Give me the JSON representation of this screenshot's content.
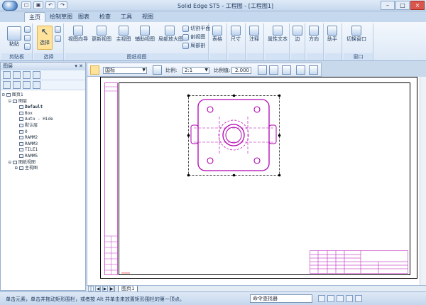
{
  "titlebar": {
    "title": "Solid Edge ST5 - 工程图 - [工程图1]",
    "controls": {
      "minimize": "–",
      "maximize": "□",
      "close": "×"
    }
  },
  "tabs": [
    {
      "label": "主页",
      "active": true
    },
    {
      "label": "绘制草图",
      "active": false
    },
    {
      "label": "图表",
      "active": false
    },
    {
      "label": "检查",
      "active": false
    },
    {
      "label": "工具",
      "active": false
    },
    {
      "label": "视图",
      "active": false
    }
  ],
  "ribbon": {
    "groups": {
      "clipboard": "剪贴板",
      "select": "选择",
      "drawing_views": "图纸视图",
      "window": "窗口"
    },
    "buttons": {
      "paste": "粘贴",
      "select": "选择",
      "view_wizard": "视图向导",
      "update_view": "更新视图",
      "principal_view": "主视图",
      "auxiliary_view": "辅助视图",
      "detail_view": "局部放大图",
      "section_plane": "切割平面",
      "section_view": "剖视图",
      "broken_out": "局部剖",
      "table": "表格",
      "dimension": "尺寸",
      "annotation": "注释",
      "property_text": "属性文本",
      "edge": "边",
      "orientation": "方向",
      "assistant": "助手",
      "switch_window": "切换窗口"
    }
  },
  "leftpanel": {
    "title": "图层",
    "tree": [
      {
        "label": "图页1",
        "indent": 0,
        "toggle": "⊟"
      },
      {
        "label": "图层",
        "indent": 1,
        "toggle": "⊟"
      },
      {
        "label": "Default",
        "indent": 2,
        "toggle": "",
        "bold": true
      },
      {
        "label": "Box",
        "indent": 2,
        "toggle": ""
      },
      {
        "label": "Auto - Hide",
        "indent": 2,
        "toggle": ""
      },
      {
        "label": "默认层",
        "indent": 2,
        "toggle": ""
      },
      {
        "label": "0",
        "indent": 2,
        "toggle": ""
      },
      {
        "label": "RAMM2",
        "indent": 2,
        "toggle": ""
      },
      {
        "label": "RAMM3",
        "indent": 2,
        "toggle": ""
      },
      {
        "label": "TILE1",
        "indent": 2,
        "toggle": ""
      },
      {
        "label": "RAMM5",
        "indent": 2,
        "toggle": ""
      },
      {
        "label": "图纸视图",
        "indent": 1,
        "toggle": "⊟"
      },
      {
        "label": "主视图",
        "indent": 2,
        "toggle": "⊞"
      }
    ]
  },
  "drawtoolbar": {
    "style_value": "国标",
    "scale_label": "比例:",
    "scale_value": "2:1",
    "ratio_label": "比例值:",
    "ratio_value": "2.000"
  },
  "sheetbar": {
    "nav": [
      "|◀",
      "◀",
      "▶",
      "▶|"
    ],
    "active_sheet": "图页1"
  },
  "statusbar": {
    "message": "单击元素，单击并拖动矩形围栏，或者按 Alt 并单击来放置矩形围栏的第一顶点。",
    "command_finder": "命令查找器"
  },
  "colors": {
    "part_outline": "#b000b0",
    "selection_box": "#000000",
    "title_block": "#b000b0"
  }
}
